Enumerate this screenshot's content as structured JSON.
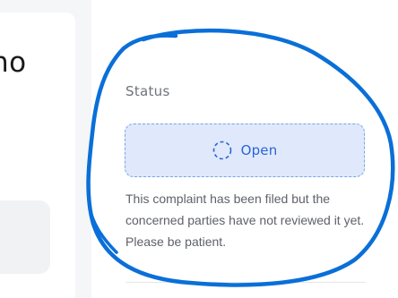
{
  "left_card": {
    "title_fragment": "no"
  },
  "status": {
    "heading": "Status",
    "value": "Open",
    "icon": "dashed-circle-icon",
    "description": "This complaint has been filed but the concerned parties have not reviewed it yet. Please be patient."
  },
  "colors": {
    "pill_background": "#dfe9fb",
    "pill_border": "#7aa2e8",
    "accent_text": "#2c63d6",
    "annotation_stroke": "#0a6fd8"
  }
}
